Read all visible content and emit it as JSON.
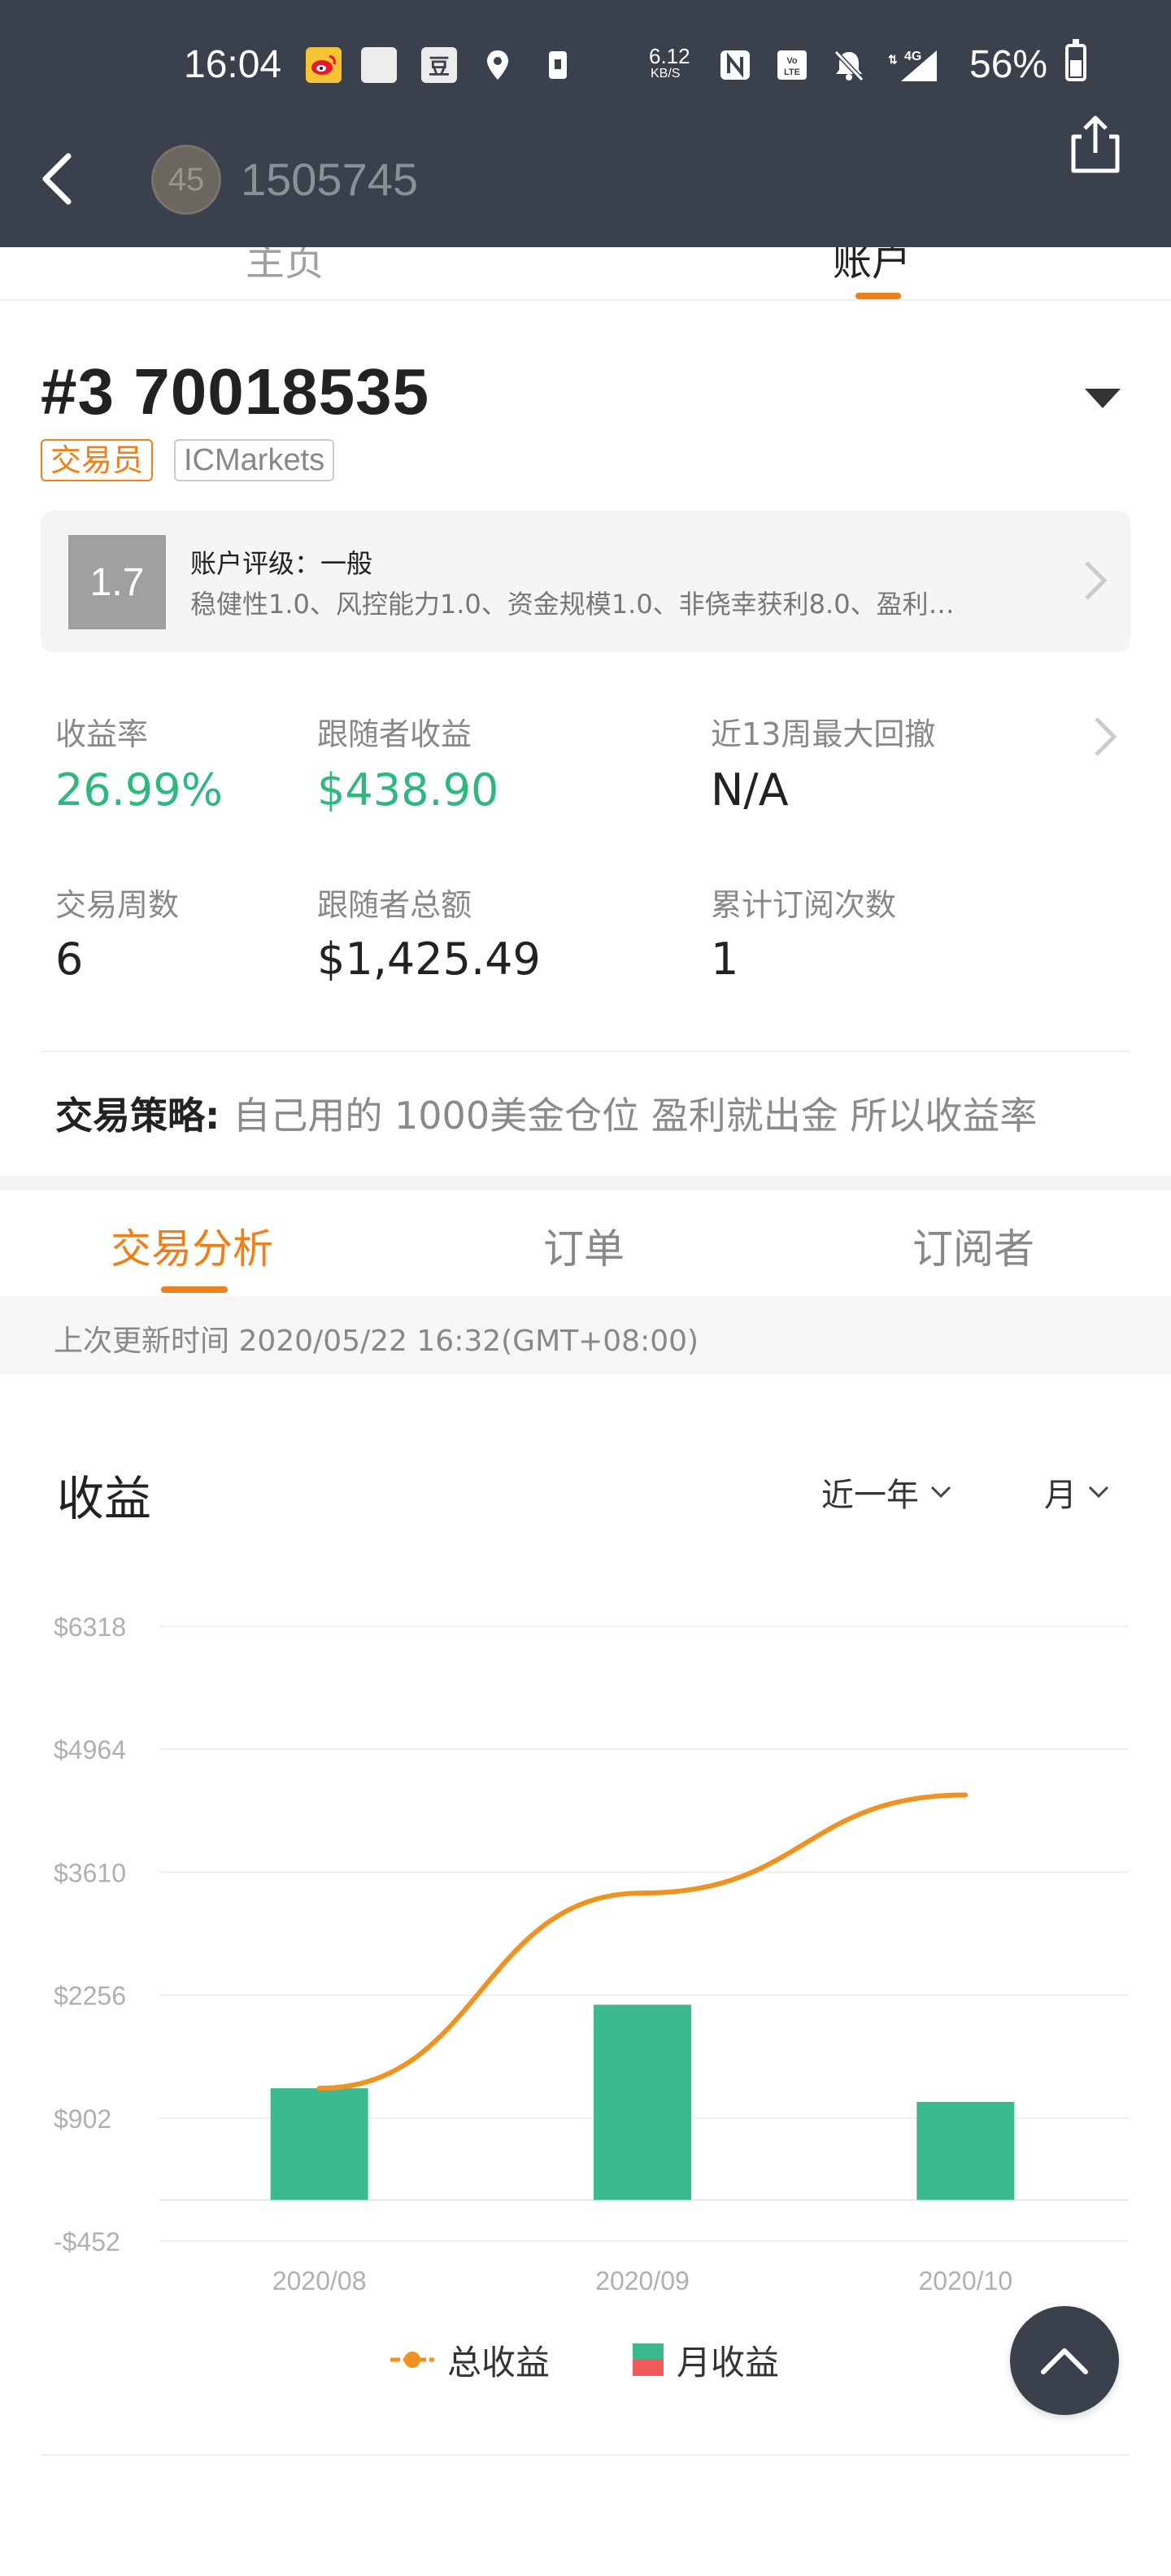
{
  "status_bar": {
    "time": "16:04",
    "icons": [
      "weibo-icon",
      "blank-app-icon",
      "douban-icon",
      "location-icon",
      "sim-icon"
    ],
    "net_speed_value": "6.12",
    "net_speed_unit": "KB/S",
    "right_icons": [
      "nfc-icon",
      "volte-icon",
      "mute-icon",
      "signal-4g-icon"
    ],
    "battery": "56%"
  },
  "header": {
    "avatar_text": "45",
    "user_id": "1505745"
  },
  "top_tabs": [
    "主页",
    "账户"
  ],
  "account": {
    "title": "#3 70018535",
    "tag_role": "交易员",
    "tag_broker": "ICMarkets",
    "rating_score": "1.7",
    "rating_title": "账户评级：一般",
    "rating_desc": "稳健性1.0、风控能力1.0、资金规模1.0、非侥幸获利8.0、盈利…"
  },
  "stats": {
    "return_label": "收益率",
    "return_value": "26.99%",
    "follower_profit_label": "跟随者收益",
    "follower_profit_value": "$438.90",
    "drawdown_label": "近13周最大回撤",
    "drawdown_value": "N/A",
    "weeks_label": "交易周数",
    "weeks_value": "6",
    "follower_total_label": "跟随者总额",
    "follower_total_value": "$1,425.49",
    "subs_label": "累计订阅次数",
    "subs_value": "1"
  },
  "strategy": {
    "label": "交易策略:",
    "text": "自己用的 1000美金仓位 盈利就出金 所以收益率"
  },
  "sub_tabs": [
    "交易分析",
    "订单",
    "订阅者"
  ],
  "last_update": "上次更新时间 2020/05/22 16:32(GMT+08:00)",
  "chart_section": {
    "title": "收益",
    "filter_period": "近一年",
    "filter_unit": "月"
  },
  "colors": {
    "accent": "#f07e19",
    "green": "#2db87d",
    "bar": "#3aba8e",
    "header_bg": "#3b414c"
  },
  "chart_data": {
    "type": "bar",
    "categories": [
      "2020/08",
      "2020/09",
      "2020/10"
    ],
    "yticks": [
      "$6318",
      "$4964",
      "$3610",
      "$2256",
      "$902",
      "-$452"
    ],
    "ylim": [
      -452,
      6318
    ],
    "series": [
      {
        "name": "月收益",
        "type": "bar",
        "values": [
          1230,
          2150,
          1080
        ]
      },
      {
        "name": "总收益",
        "type": "line",
        "values": [
          1230,
          3380,
          4460
        ]
      }
    ],
    "legend": [
      "总收益",
      "月收益"
    ],
    "legend_position": "bottom"
  }
}
